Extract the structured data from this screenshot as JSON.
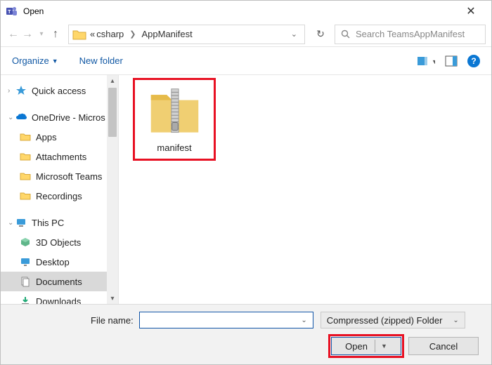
{
  "window": {
    "title": "Open"
  },
  "breadcrumb": {
    "prefix": "«",
    "items": [
      "csharp",
      "AppManifest"
    ]
  },
  "search": {
    "placeholder": "Search TeamsAppManifest"
  },
  "commandbar": {
    "organize": "Organize",
    "new_folder": "New folder"
  },
  "tree": {
    "quick_access": "Quick access",
    "onedrive": "OneDrive - Micros",
    "onedrive_children": [
      "Apps",
      "Attachments",
      "Microsoft Teams",
      "Recordings"
    ],
    "this_pc": "This PC",
    "this_pc_children": [
      "3D Objects",
      "Desktop",
      "Documents",
      "Downloads"
    ]
  },
  "content": {
    "file_name": "manifest"
  },
  "footer": {
    "file_name_label": "File name:",
    "file_name_value": "",
    "filter": "Compressed (zipped) Folder",
    "open": "Open",
    "cancel": "Cancel"
  }
}
